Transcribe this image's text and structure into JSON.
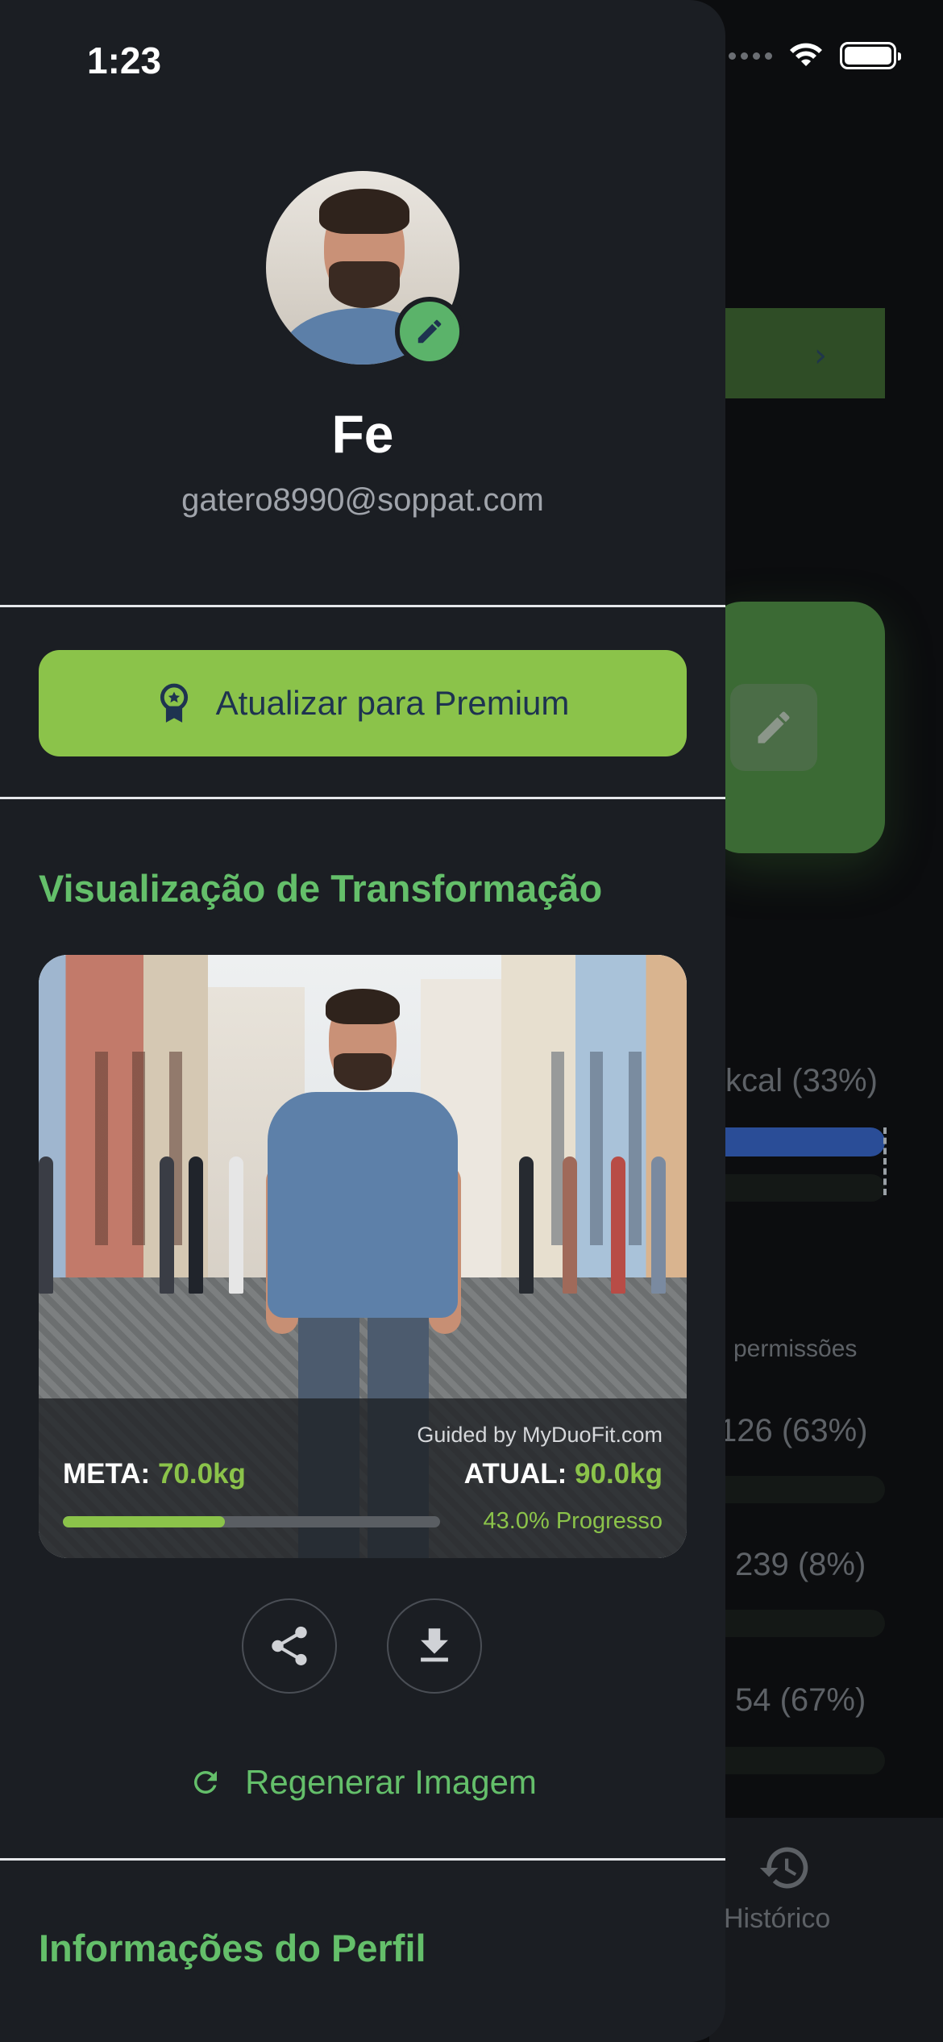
{
  "status_bar": {
    "time": "1:23"
  },
  "profile": {
    "name": "Fe",
    "email": "gatero8990@soppat.com"
  },
  "premium_button": {
    "label": "Atualizar para Premium"
  },
  "transformation": {
    "title": "Visualização de Transformação",
    "watermark": "Guided by MyDuoFit.com",
    "goal_label": "META:",
    "goal_value": "70.0kg",
    "current_label": "ATUAL:",
    "current_value": "90.0kg",
    "progress_fraction": 0.43,
    "progress_text": "43.0% Progresso",
    "regenerate_label": "Regenerar Imagem"
  },
  "profile_info": {
    "title": "Informações do Perfil"
  },
  "background_screen": {
    "kcal_text": "kcal (33%)",
    "permissions_text": "permissões",
    "stat_1": "126 (63%)",
    "stat_2": "239 (8%)",
    "stat_3": "54 (67%)",
    "nav_history_label": "Histórico"
  },
  "colors": {
    "accent_green": "#8bc34a",
    "title_green": "#64bf6a",
    "drawer_bg": "#1b1e23"
  },
  "icons": {
    "premium": "award-badge-icon",
    "edit": "pencil-icon",
    "share": "share-icon",
    "download": "download-icon",
    "regenerate": "refresh-icon",
    "history": "history-icon"
  }
}
